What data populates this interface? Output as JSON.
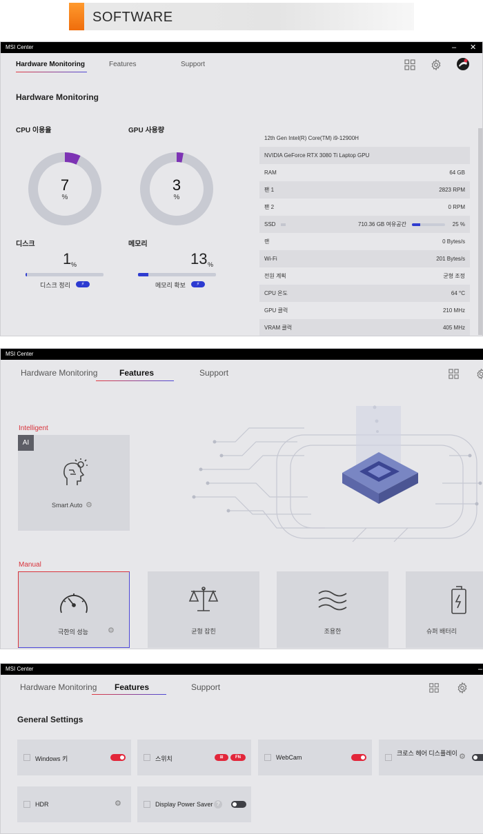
{
  "banner": {
    "title": "SOFTWARE"
  },
  "colors": {
    "accent_red": "#e2383f",
    "accent_blue": "#2f3cd0",
    "window_bg": "#e7e7ea"
  },
  "window1": {
    "app_title": "MSI Center",
    "tabs": [
      "Hardware Monitoring",
      "Features",
      "Support"
    ],
    "active_tab": "Hardware Monitoring",
    "heading": "Hardware Monitoring",
    "cpu": {
      "label": "CPU 이용율",
      "value": "7",
      "unit": "%",
      "fraction": 0.07
    },
    "gpu": {
      "label": "GPU 사용량",
      "value": "3",
      "unit": "%",
      "fraction": 0.03
    },
    "disk": {
      "label": "디스크",
      "value": "1",
      "unit": "%",
      "fraction": 0.01,
      "action": "디스크 정리"
    },
    "memory": {
      "label": "메모리",
      "value": "13",
      "unit": "%",
      "fraction": 0.13,
      "action": "메모리 확보"
    },
    "info": [
      {
        "key": "12th Gen Intel(R) Core(TM) i9-12900H",
        "value": ""
      },
      {
        "key": "NVIDIA GeForce RTX 3080 Ti Laptop GPU",
        "value": ""
      },
      {
        "key": "RAM",
        "value": "64 GB"
      },
      {
        "key": "팬 1",
        "value": "2823 RPM"
      },
      {
        "key": "팬 2",
        "value": "0 RPM"
      },
      {
        "key": "SSD",
        "value": "25 %",
        "detail": "710.36 GB 여유공간",
        "fraction": 0.25
      },
      {
        "key": "랜",
        "value": "0 Bytes/s"
      },
      {
        "key": "Wi-Fi",
        "value": "201 Bytes/s"
      },
      {
        "key": "전원 계획",
        "value": "균형 조정"
      },
      {
        "key": "CPU 온도",
        "value": "64 °C"
      },
      {
        "key": "GPU 클럭",
        "value": "210 MHz"
      },
      {
        "key": "VRAM 클럭",
        "value": "405 MHz"
      }
    ]
  },
  "window2": {
    "app_title": "MSI Center",
    "tabs": [
      "Hardware Monitoring",
      "Features",
      "Support"
    ],
    "active_tab": "Features",
    "intelligent_label": "Intelligent",
    "ai_badge": "AI",
    "smart_auto": "Smart Auto",
    "manual_label": "Manual",
    "modes": [
      "극한의 성능",
      "균형 잡힌",
      "조용한",
      "슈퍼 배터리"
    ],
    "selected_mode": "극한의 성능"
  },
  "window3": {
    "app_title": "MSI Center",
    "tabs": [
      "Hardware Monitoring",
      "Features",
      "Support"
    ],
    "active_tab": "Features",
    "heading": "General Settings",
    "settings": [
      {
        "label": "Windows 키",
        "state": "on"
      },
      {
        "label": "스위치",
        "tag": "FN"
      },
      {
        "label": "WebCam",
        "state": "on"
      },
      {
        "label": "크로스 헤어 디스플레이",
        "state": "off"
      },
      {
        "label": "HDR"
      },
      {
        "label": "Display Power Saver",
        "state": "off",
        "help": "?"
      }
    ]
  }
}
